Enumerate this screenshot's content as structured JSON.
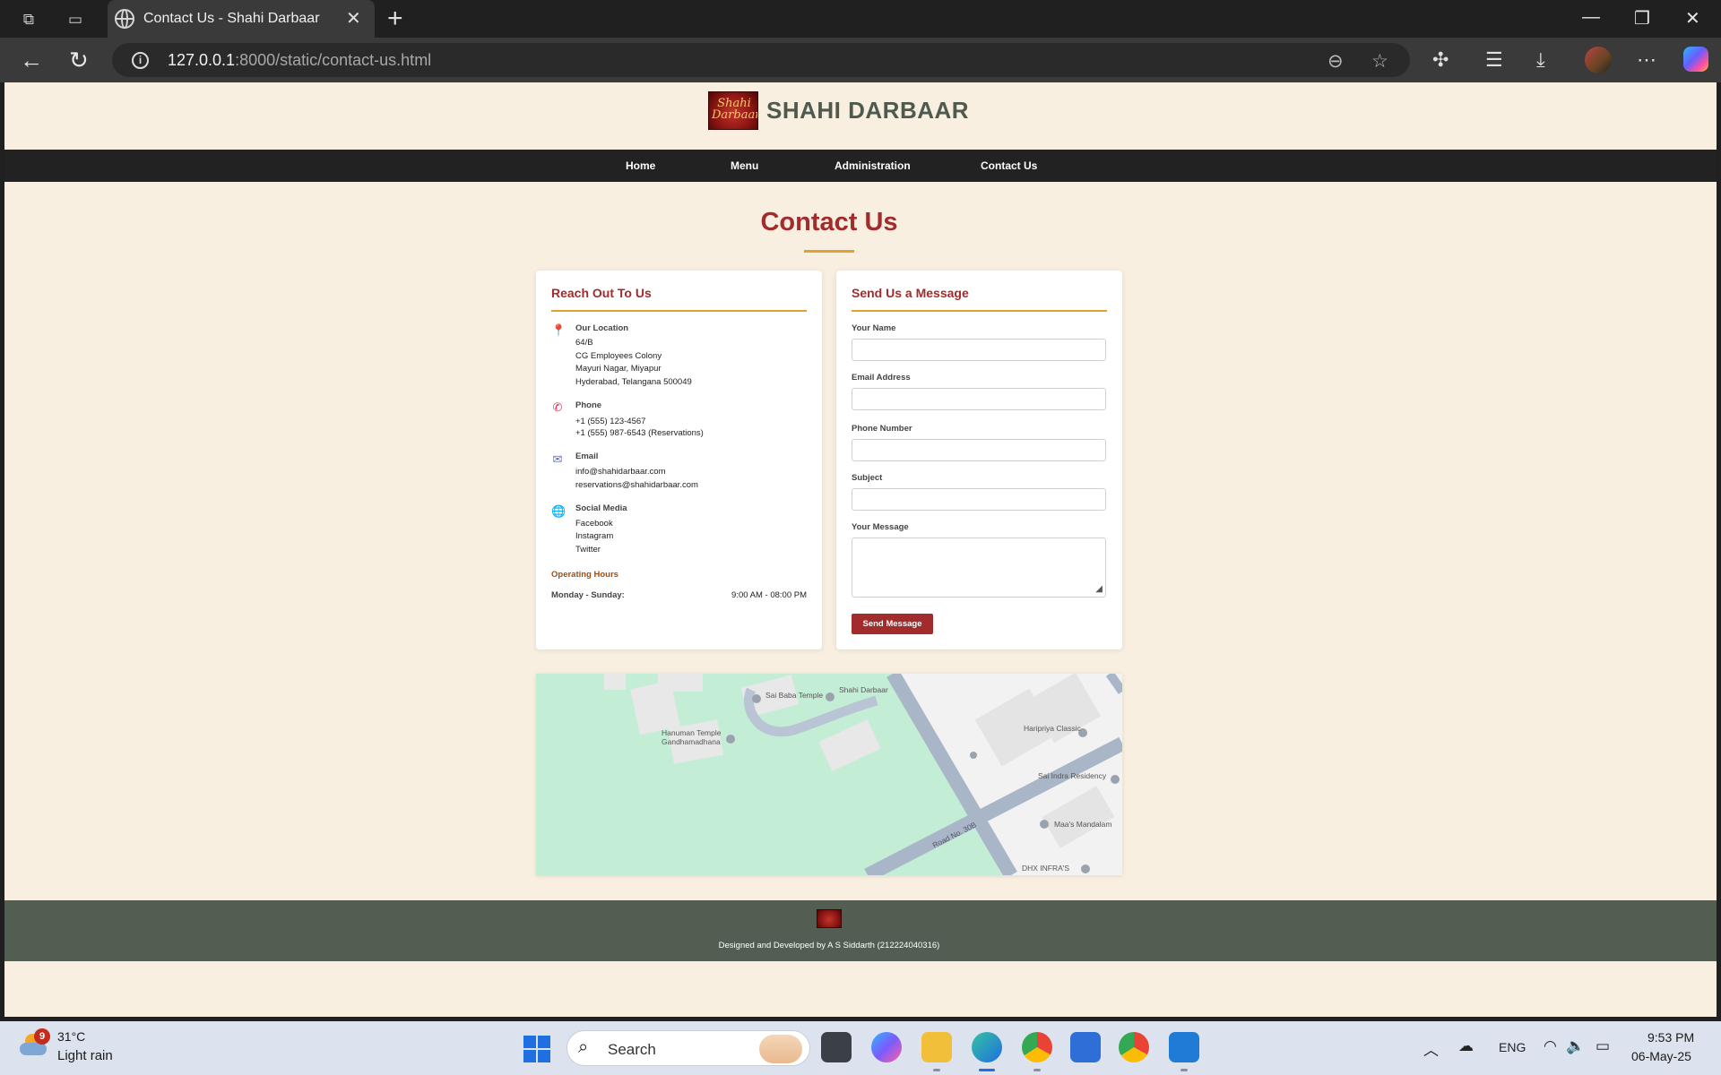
{
  "browser": {
    "tab_title": "Contact Us - Shahi Darbaar",
    "url_host": "127.0.0.1",
    "url_rest": ":8000/static/contact-us.html"
  },
  "site": {
    "brand": "SHAHI DARBAAR",
    "logo_text": "Shahi Darbaar",
    "nav": [
      "Home",
      "Menu",
      "Administration",
      "Contact Us"
    ],
    "page_title": "Contact Us"
  },
  "reach_out": {
    "heading": "Reach Out To Us",
    "location": {
      "title": "Our Location",
      "lines": [
        "64/B",
        "CG Employees Colony",
        "Mayuri Nagar, Miyapur",
        "Hyderabad, Telangana 500049"
      ]
    },
    "phone": {
      "title": "Phone",
      "lines": [
        "+1 (555) 123-4567",
        "+1 (555) 987-6543 (Reservations)"
      ]
    },
    "email": {
      "title": "Email",
      "lines": [
        "info@shahidarbaar.com",
        "reservations@shahidarbaar.com"
      ]
    },
    "social": {
      "title": "Social Media",
      "lines": [
        "Facebook",
        "Instagram",
        "Twitter"
      ]
    },
    "hours": {
      "heading": "Operating Hours",
      "day": "Monday - Sunday:",
      "time": "9:00 AM - 08:00 PM"
    }
  },
  "form": {
    "heading": "Send Us a Message",
    "name_label": "Your Name",
    "email_label": "Email Address",
    "phone_label": "Phone Number",
    "subject_label": "Subject",
    "message_label": "Your Message",
    "submit": "Send Message"
  },
  "map": {
    "labels": [
      "Sai Baba Temple",
      "Shahi Darbaar",
      "Hanuman Temple Gandhamadhana",
      "Haripriya Classic",
      "Sai Indra Residency",
      "Maa's Mandalam",
      "DHX INFRA'S",
      "Road No. 30B"
    ]
  },
  "footer": {
    "credit": "Designed and Developed by A S Siddarth (212224040316)"
  },
  "taskbar": {
    "weather_badge": "9",
    "temperature": "31°C",
    "condition": "Light rain",
    "search": "Search",
    "language": "ENG",
    "time": "9:53 PM",
    "date": "06-May-25"
  },
  "colors": {
    "accent_red": "#a22b2b",
    "accent_gold": "#e0a331",
    "page_bg": "#f9efe1",
    "footer_bg": "#525e52",
    "nav_bg": "#222222"
  },
  "icons": [
    "workspaces-icon",
    "tab-actions-icon",
    "globe-icon",
    "close-icon",
    "plus-icon",
    "back-icon",
    "refresh-icon",
    "info-icon",
    "zoom-icon",
    "star-icon",
    "extensions-icon",
    "favorites-icon",
    "download-icon",
    "more-icon",
    "location-pin-icon",
    "phone-icon",
    "email-icon",
    "globe-social-icon"
  ]
}
